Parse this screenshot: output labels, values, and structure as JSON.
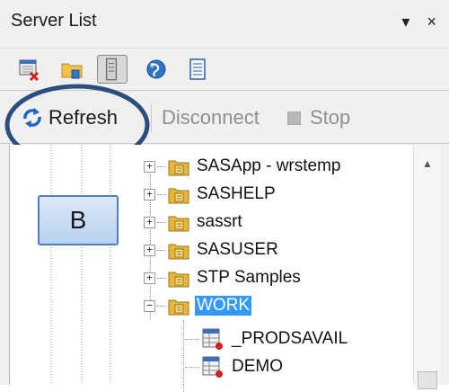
{
  "window": {
    "title": "Server List",
    "pin_glyph": "▾",
    "close_glyph": "×"
  },
  "icon_toolbar": [
    {
      "name": "new-server-icon"
    },
    {
      "name": "open-folder-icon"
    },
    {
      "name": "server-view-icon",
      "pressed": true
    },
    {
      "name": "globe-icon"
    },
    {
      "name": "document-icon"
    }
  ],
  "command_bar": {
    "refresh_label": "Refresh",
    "disconnect_label": "Disconnect",
    "stop_label": "Stop"
  },
  "callout": {
    "label": "B"
  },
  "tree": {
    "libraries": [
      {
        "label": "SASApp - wrstemp",
        "expander": "+"
      },
      {
        "label": "SASHELP",
        "expander": "+"
      },
      {
        "label": "sassrt",
        "expander": "+"
      },
      {
        "label": "SASUSER",
        "expander": "+"
      },
      {
        "label": "STP Samples",
        "expander": "+"
      },
      {
        "label": "WORK",
        "expander": "−",
        "selected": true
      }
    ],
    "tables": [
      {
        "label": "_PRODSAVAIL"
      },
      {
        "label": "DEMO"
      }
    ]
  },
  "colors": {
    "selection": "#3399ff",
    "annotation": "#2b4e7e",
    "folder": "#e6b73a"
  }
}
